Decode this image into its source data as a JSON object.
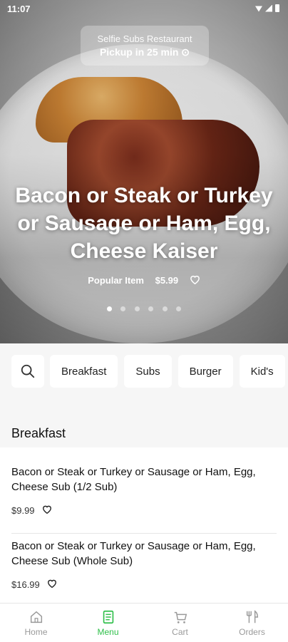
{
  "status": {
    "time": "11:07"
  },
  "hero": {
    "restaurant": "Selfie Subs Restaurant",
    "pickup": "Pickup in 25 min ⊙",
    "title": "Bacon or Steak or Turkey or Sausage or Ham, Egg, Cheese Kaiser",
    "tag": "Popular Item",
    "price": "$5.99",
    "dots": 6,
    "active_dot": 0
  },
  "categories": {
    "chips": [
      "Breakfast",
      "Subs",
      "Burger",
      "Kid's"
    ]
  },
  "section": {
    "title": "Breakfast"
  },
  "items": [
    {
      "name": "Bacon or Steak or Turkey or Sausage or Ham, Egg, Cheese Sub (1/2 Sub)",
      "price": "$9.99"
    },
    {
      "name": "Bacon or Steak or Turkey or Sausage or Ham, Egg, Cheese Sub (Whole Sub)",
      "price": "$16.99"
    }
  ],
  "nav": [
    {
      "label": "Home",
      "icon": "home-icon"
    },
    {
      "label": "Menu",
      "icon": "menu-icon"
    },
    {
      "label": "Cart",
      "icon": "cart-icon"
    },
    {
      "label": "Orders",
      "icon": "orders-icon"
    }
  ],
  "colors": {
    "accent": "#2fbf4a",
    "inactive": "#9a9a9a"
  }
}
